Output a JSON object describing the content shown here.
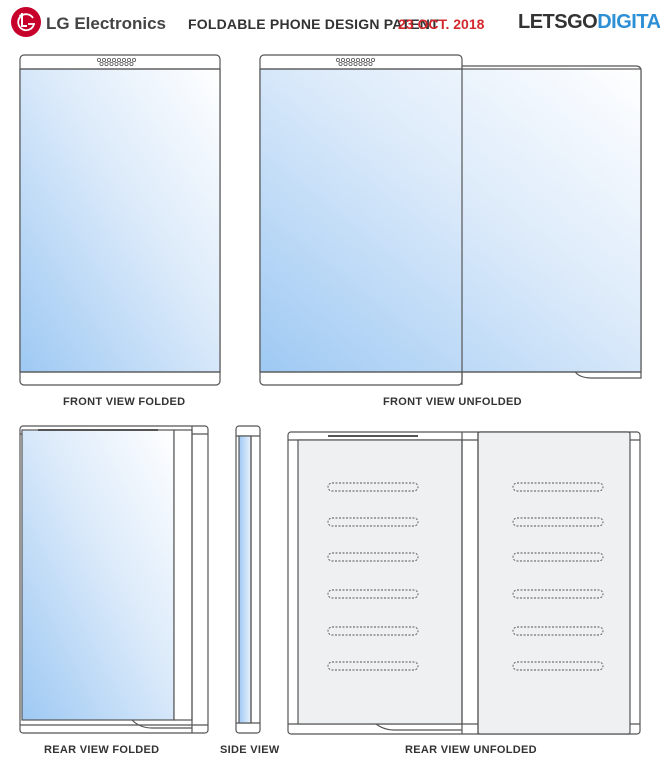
{
  "header": {
    "brand": "LG Electronics",
    "title": "FOLDABLE PHONE DESIGN PATENT",
    "date": "23 OCT. 2018",
    "site_part1": "LETSGO",
    "site_part2": "DIGITAL"
  },
  "captions": {
    "front_folded": "FRONT VIEW FOLDED",
    "front_unfolded": "FRONT VIEW UNFOLDED",
    "rear_folded": "REAR VIEW FOLDED",
    "side": "SIDE VIEW",
    "rear_unfolded": "REAR VIEW UNFOLDED"
  },
  "colors": {
    "brand_red": "#c6002b",
    "date_red": "#d3282c",
    "site_blue": "#2d8fd5",
    "screen_blue": "#a9d0f5",
    "outline": "#555555"
  },
  "icons": [
    "lg-logo-icon"
  ]
}
